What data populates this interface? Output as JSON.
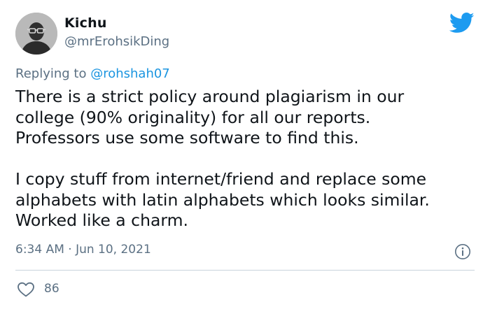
{
  "user": {
    "display_name": "Kichu",
    "handle": "@mrErohsikDing",
    "avatar_icon": "avatar-glasses-figure"
  },
  "reply": {
    "prefix": "Replying to ",
    "mention": "@rohshah07"
  },
  "tweet_lines": [
    "There is a strict policy around plagiarism in our",
    "college (90% originality) for all our reports.",
    "Professors use some software to find this.",
    "",
    "I copy stuff from internet/friend and replace some",
    "alphabets with latin alphabets which looks similar.",
    "Worked like a charm."
  ],
  "timestamp": "6:34 AM · Jun 10, 2021",
  "likes": "86",
  "icons": {
    "brand": "twitter-bird-icon",
    "info": "info-icon",
    "like": "heart-icon"
  },
  "colors": {
    "brand_blue": "#1d9bf0",
    "mention_blue": "#1b95e0",
    "secondary_text": "#5b7083",
    "primary_text": "#0f1419"
  }
}
